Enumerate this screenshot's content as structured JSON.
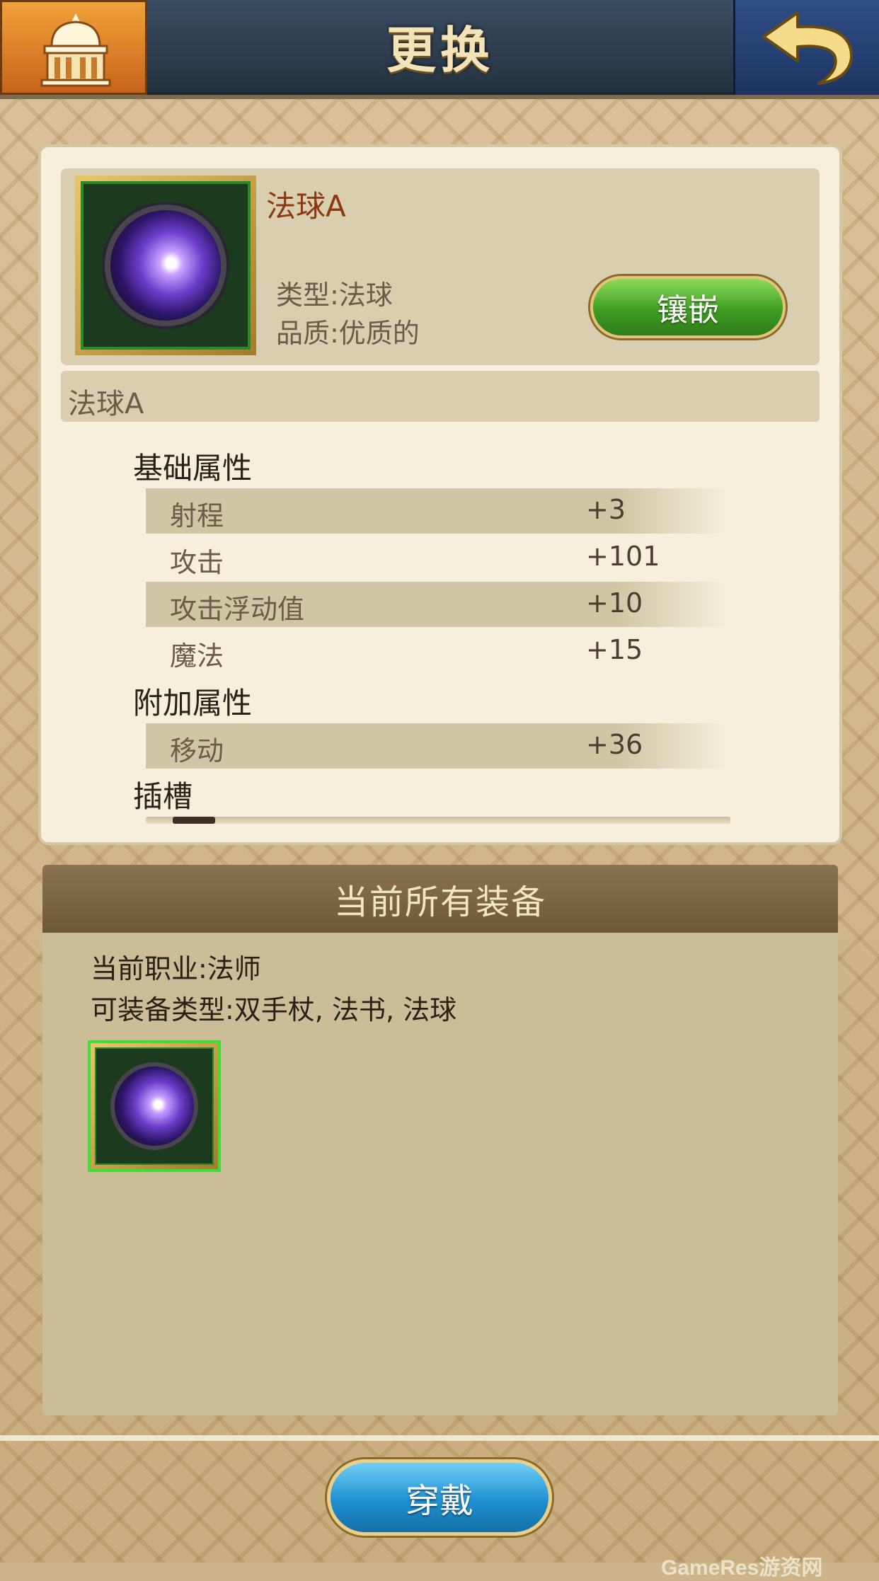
{
  "header": {
    "title": "更换",
    "home_icon": "home-icon",
    "back_icon": "back-arrow-icon"
  },
  "item": {
    "name": "法球A",
    "type": "类型:法球",
    "quality": "品质:优质的",
    "inlay_label": "镶嵌",
    "description": "法球A",
    "icon": "magic-orb-icon"
  },
  "attributes": {
    "base_title": "基础属性",
    "base": [
      {
        "name": "射程",
        "value": "+3"
      },
      {
        "name": "攻击",
        "value": "+101"
      },
      {
        "name": "攻击浮动值",
        "value": "+10"
      },
      {
        "name": "魔法",
        "value": "+15"
      }
    ],
    "extra_title": "附加属性",
    "extra": [
      {
        "name": "移动",
        "value": "+36"
      }
    ],
    "slot_title": "插槽"
  },
  "owned": {
    "title": "当前所有装备",
    "job": "当前职业:法师",
    "equip_types": "可装备类型:双手杖,  法书,  法球"
  },
  "footer": {
    "wear_label": "穿戴"
  },
  "watermark": "GameRes游资网",
  "colors": {
    "title_bar": "#2e3e52",
    "home_button": "#e0862c",
    "back_button": "#26427a",
    "inlay_button": "#3f9d22",
    "wear_button": "#1f8fd0",
    "selected_border": "#3fdc3a"
  }
}
